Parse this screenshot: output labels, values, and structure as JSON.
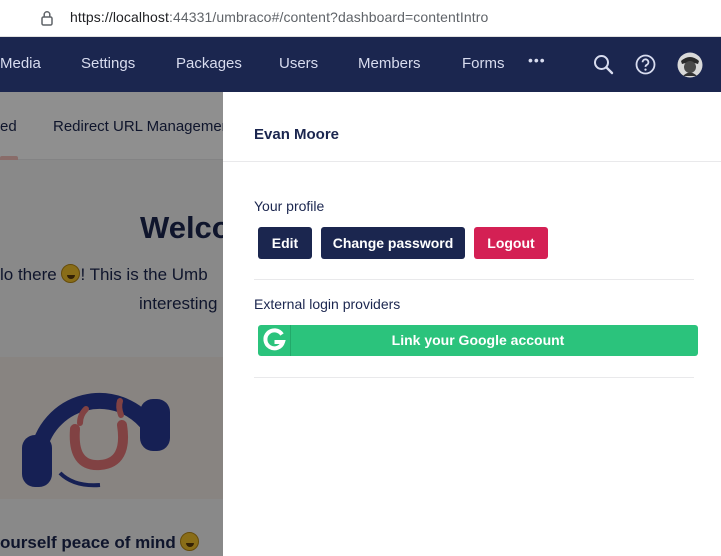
{
  "browser": {
    "url_host": "https://localhost",
    "url_rest": ":44331/umbraco#/content?dashboard=contentIntro"
  },
  "topnav": {
    "items": [
      "Media",
      "Settings",
      "Packages",
      "Users",
      "Members",
      "Forms"
    ],
    "more_label": "•••",
    "bg_color": "#1b264f"
  },
  "dashboard": {
    "tabs": [
      "ed",
      "Redirect URL Managemen"
    ],
    "welcome": "Welco",
    "intro_line1_a": "lo there ",
    "intro_line1_b": "! This is the Umb",
    "intro_line2": "interesting",
    "peace": "ourself peace of mind "
  },
  "profile": {
    "name": "Evan Moore",
    "your_profile_label": "Your profile",
    "edit_label": "Edit",
    "change_password_label": "Change password",
    "logout_label": "Logout",
    "external_label": "External login providers",
    "google_label": "Link your Google account"
  },
  "colors": {
    "navy": "#1b264f",
    "logout_red": "#d42054",
    "google_green": "#2bc37c"
  }
}
